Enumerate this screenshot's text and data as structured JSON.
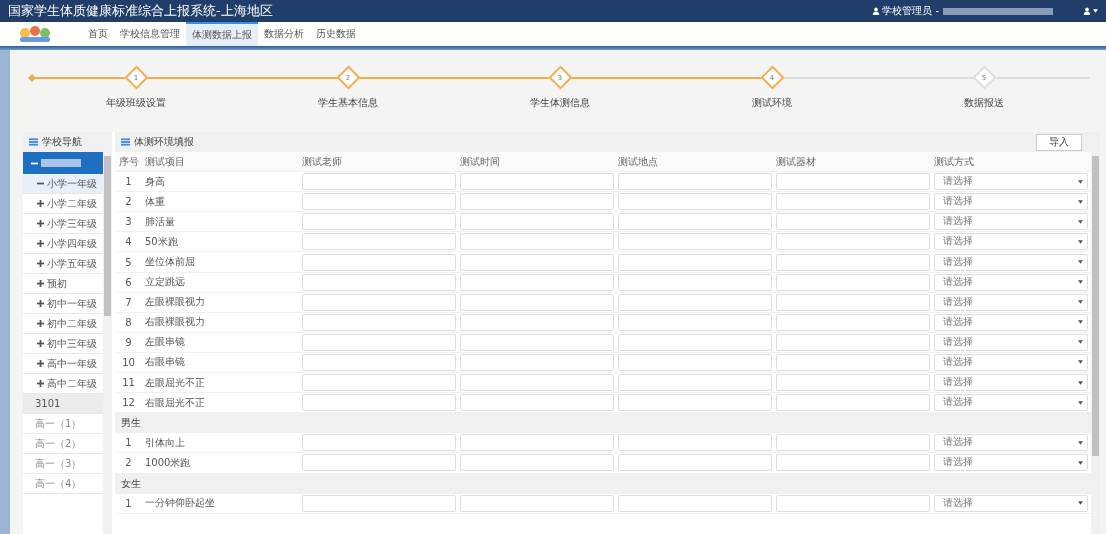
{
  "header": {
    "title": "国家学生体质健康标准综合上报系统-上海地区",
    "user_role": "学校管理员 -"
  },
  "nav": [
    {
      "label": "首页",
      "selected": false
    },
    {
      "label": "学校信息管理",
      "selected": false
    },
    {
      "label": "体测数据上报",
      "selected": true
    },
    {
      "label": "数据分析",
      "selected": false
    },
    {
      "label": "历史数据",
      "selected": false
    }
  ],
  "steps": [
    {
      "number": "1",
      "label": "年级班级设置",
      "done": true
    },
    {
      "number": "2",
      "label": "学生基本信息",
      "done": true
    },
    {
      "number": "3",
      "label": "学生体测信息",
      "done": true
    },
    {
      "number": "4",
      "label": "测试环境",
      "done": true
    },
    {
      "number": "5",
      "label": "数据报送",
      "done": false
    }
  ],
  "sidebar": {
    "title": "学校导航",
    "root": {
      "selected": true,
      "expanded": true
    },
    "items": [
      {
        "kind": "grade",
        "label": "小学一年级",
        "expanded": true,
        "selected": true
      },
      {
        "kind": "grade",
        "label": "小学二年级",
        "expanded": false,
        "selected": false
      },
      {
        "kind": "grade",
        "label": "小学三年级",
        "expanded": false,
        "selected": false
      },
      {
        "kind": "grade",
        "label": "小学四年级",
        "expanded": false,
        "selected": false
      },
      {
        "kind": "grade",
        "label": "小学五年级",
        "expanded": false,
        "selected": false
      },
      {
        "kind": "grade",
        "label": "预初",
        "expanded": false,
        "selected": false
      },
      {
        "kind": "grade",
        "label": "初中一年级",
        "expanded": false,
        "selected": false
      },
      {
        "kind": "grade",
        "label": "初中二年级",
        "expanded": false,
        "selected": false
      },
      {
        "kind": "grade",
        "label": "初中三年级",
        "expanded": false,
        "selected": false
      },
      {
        "kind": "grade",
        "label": "高中一年级",
        "expanded": false,
        "selected": false
      },
      {
        "kind": "grade",
        "label": "高中二年级",
        "expanded": false,
        "selected": false
      },
      {
        "kind": "group",
        "label": "3101",
        "selected": false
      },
      {
        "kind": "class",
        "label": "高一（1）",
        "selected": false
      },
      {
        "kind": "class",
        "label": "高一（2）",
        "selected": false
      },
      {
        "kind": "class",
        "label": "高一（3）",
        "selected": false
      },
      {
        "kind": "class",
        "label": "高一（4）",
        "selected": false
      }
    ]
  },
  "panel": {
    "title": "体测环境填报",
    "import_button": "导入",
    "columns": [
      "序号",
      "测试项目",
      "测试老师",
      "测试时间",
      "测试地点",
      "测试器材",
      "测试方式"
    ],
    "groups": [
      {
        "rows": [
          {
            "no": "1",
            "item": "身高",
            "method": "请选择"
          },
          {
            "no": "2",
            "item": "体重",
            "method": "请选择"
          },
          {
            "no": "3",
            "item": "肺活量",
            "method": "请选择"
          },
          {
            "no": "4",
            "item": "50米跑",
            "method": "请选择"
          },
          {
            "no": "5",
            "item": "坐位体前屈",
            "method": "请选择"
          },
          {
            "no": "6",
            "item": "立定跳远",
            "method": "请选择"
          },
          {
            "no": "7",
            "item": "左眼裸眼视力",
            "method": "请选择"
          },
          {
            "no": "8",
            "item": "右眼裸眼视力",
            "method": "请选择"
          },
          {
            "no": "9",
            "item": "左眼串镜",
            "method": "请选择"
          },
          {
            "no": "10",
            "item": "右眼串镜",
            "method": "请选择"
          },
          {
            "no": "11",
            "item": "左眼屈光不正",
            "method": "请选择"
          },
          {
            "no": "12",
            "item": "右眼屈光不正",
            "method": "请选择"
          }
        ]
      },
      {
        "title": "男生",
        "rows": [
          {
            "no": "1",
            "item": "引体向上",
            "method": "请选择"
          },
          {
            "no": "2",
            "item": "1000米跑",
            "method": "请选择"
          }
        ]
      },
      {
        "title": "女生",
        "rows": [
          {
            "no": "1",
            "item": "一分钟仰卧起坐",
            "method": "请选择"
          }
        ]
      }
    ]
  }
}
